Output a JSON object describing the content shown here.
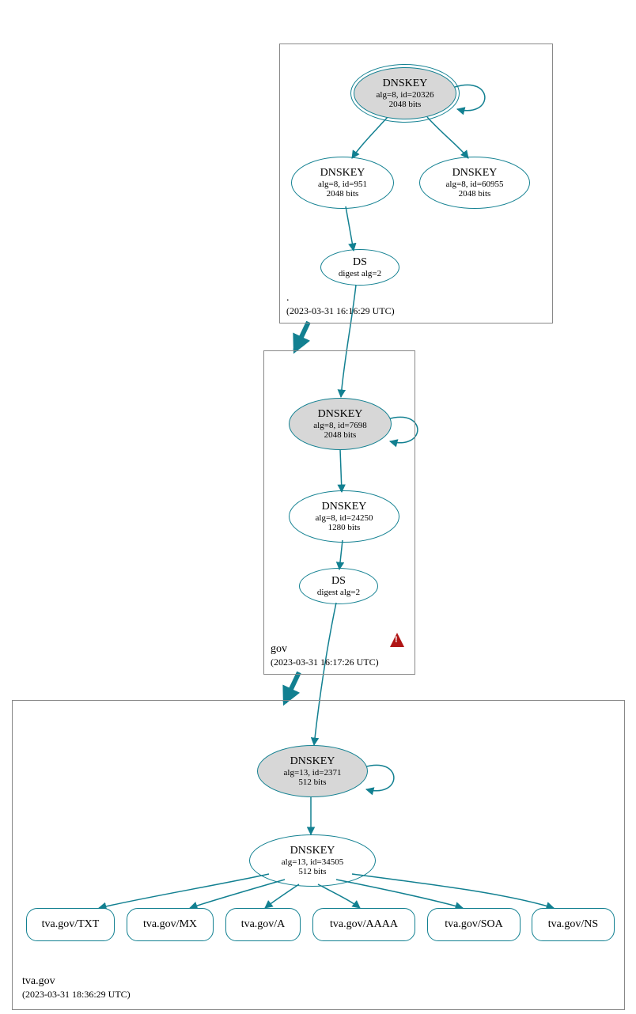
{
  "zones": {
    "root": {
      "label": ".",
      "timestamp": "(2023-03-31 16:16:29 UTC)"
    },
    "gov": {
      "label": "gov",
      "timestamp": "(2023-03-31 16:17:26 UTC)"
    },
    "tvagov": {
      "label": "tva.gov",
      "timestamp": "(2023-03-31 18:36:29 UTC)"
    }
  },
  "nodes": {
    "root_ksk": {
      "title": "DNSKEY",
      "sub1": "alg=8, id=20326",
      "sub2": "2048 bits"
    },
    "root_zsk1": {
      "title": "DNSKEY",
      "sub1": "alg=8, id=951",
      "sub2": "2048 bits"
    },
    "root_zsk2": {
      "title": "DNSKEY",
      "sub1": "alg=8, id=60955",
      "sub2": "2048 bits"
    },
    "root_ds": {
      "title": "DS",
      "sub1": "digest alg=2"
    },
    "gov_ksk": {
      "title": "DNSKEY",
      "sub1": "alg=8, id=7698",
      "sub2": "2048 bits"
    },
    "gov_zsk": {
      "title": "DNSKEY",
      "sub1": "alg=8, id=24250",
      "sub2": "1280 bits"
    },
    "gov_ds": {
      "title": "DS",
      "sub1": "digest alg=2"
    },
    "tva_ksk": {
      "title": "DNSKEY",
      "sub1": "alg=13, id=2371",
      "sub2": "512 bits"
    },
    "tva_zsk": {
      "title": "DNSKEY",
      "sub1": "alg=13, id=34505",
      "sub2": "512 bits"
    }
  },
  "rrsets": {
    "txt": "tva.gov/TXT",
    "mx": "tva.gov/MX",
    "a": "tva.gov/A",
    "aaaa": "tva.gov/AAAA",
    "soa": "tva.gov/SOA",
    "ns": "tva.gov/NS"
  }
}
